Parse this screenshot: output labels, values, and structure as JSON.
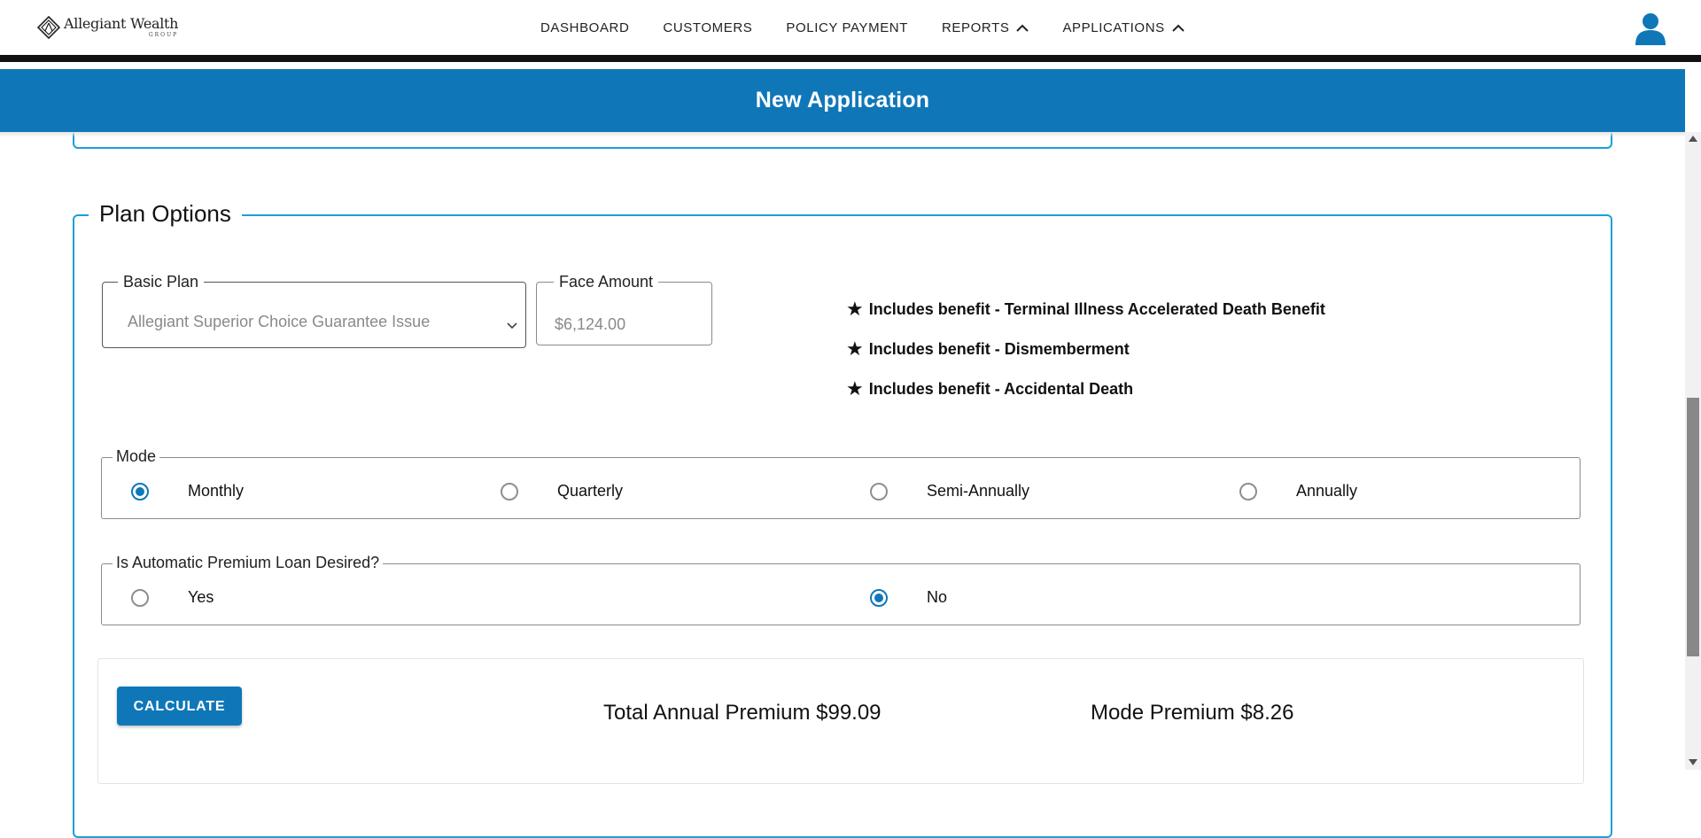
{
  "brand": {
    "name": "Allegiant Wealth",
    "sub": "GROUP"
  },
  "nav": {
    "items": [
      {
        "label": "DASHBOARD",
        "has_chevron": false
      },
      {
        "label": "CUSTOMERS",
        "has_chevron": false
      },
      {
        "label": "POLICY PAYMENT",
        "has_chevron": false
      },
      {
        "label": "REPORTS",
        "has_chevron": true
      },
      {
        "label": "APPLICATIONS",
        "has_chevron": true
      }
    ],
    "user_icon": "user-icon"
  },
  "header": {
    "title": "New Application"
  },
  "plan_options": {
    "title": "Plan Options",
    "basic_plan": {
      "label": "Basic Plan",
      "value": "Allegiant Superior Choice Guarantee Issue"
    },
    "face_amount": {
      "label": "Face Amount",
      "value": "$6,124.00"
    },
    "benefits": [
      "Includes benefit - Terminal Illness Accelerated Death Benefit",
      "Includes benefit - Dismemberment",
      "Includes benefit - Accidental Death"
    ],
    "mode": {
      "label": "Mode",
      "options": [
        "Monthly",
        "Quarterly",
        "Semi-Annually",
        "Annually"
      ],
      "selected": "Monthly"
    },
    "apl": {
      "label": "Is Automatic Premium Loan Desired?",
      "options": [
        "Yes",
        "No"
      ],
      "selected": "No"
    },
    "calculate": {
      "button": "CALCULATE",
      "total_annual_premium": "Total Annual Premium $99.09",
      "mode_premium": "Mode Premium $8.26"
    }
  },
  "colors": {
    "primary": "#0f77b8",
    "fieldset_border": "#1aa0d8",
    "nav_rule": "#111111"
  }
}
